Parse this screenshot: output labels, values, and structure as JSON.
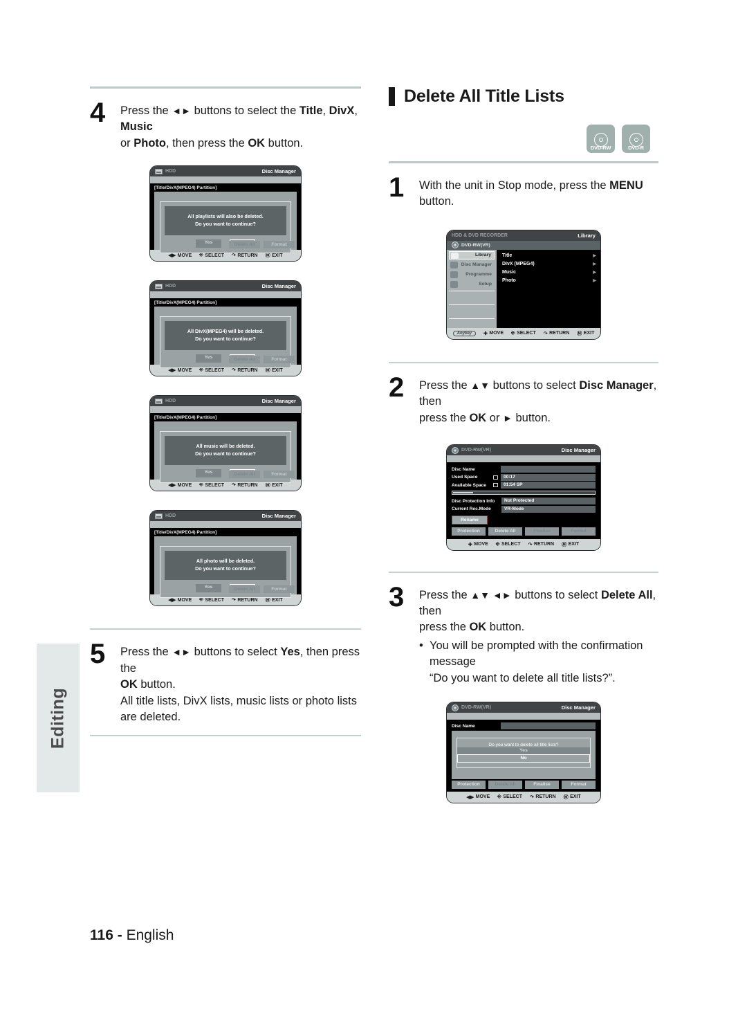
{
  "side_tab": {
    "label": "Editing"
  },
  "footer": {
    "page": "116 -",
    "language": "English"
  },
  "left_column": {
    "step4": {
      "number": "4",
      "text_parts": [
        {
          "t": "Press the ",
          "b": false
        },
        {
          "t": "◄►",
          "b": false
        },
        {
          "t": " buttons to select the ",
          "b": false
        },
        {
          "t": "Title",
          "b": true
        },
        {
          "t": ", ",
          "b": false
        },
        {
          "t": "DivX",
          "b": true
        },
        {
          "t": ", ",
          "b": false
        },
        {
          "t": "Music",
          "b": true
        },
        {
          "t": " or ",
          "b": false
        },
        {
          "t": "Photo",
          "b": true
        },
        {
          "t": ", then press the ",
          "b": false
        },
        {
          "t": "OK",
          "b": true
        },
        {
          "t": " button.",
          "b": false
        }
      ],
      "plain": "Press the ◄► buttons to select the Title, DivX, Music or Photo, then press the OK button."
    },
    "step5": {
      "number": "5",
      "line1": "Press the ◄► buttons to select Yes, then press the",
      "line2": "OK button.",
      "line3": "All title lists, DivX lists, music lists or photo lists are deleted."
    },
    "shots": [
      {
        "name": "hdd-playlists-dialog",
        "source": "HDD",
        "title": "Disc Manager",
        "partition_label": "[Title/DivX(MPEG4) Partition]",
        "message_line1": "All playlists will also be deleted.",
        "message_line2": "Do you want to continue?",
        "yes": "Yes",
        "no": "No",
        "selected": "No",
        "low_buttons": [
          "Delete All",
          "Format"
        ],
        "bottom_bar": [
          "MOVE",
          "SELECT",
          "RETURN",
          "EXIT"
        ]
      },
      {
        "name": "hdd-divx-dialog",
        "source": "HDD",
        "title": "Disc Manager",
        "partition_label": "[Title/DivX(MPEG4) Partition]",
        "message_line1": "All DivX(MPEG4) will be deleted.",
        "message_line2": "Do you want to continue?",
        "yes": "Yes",
        "no": "No",
        "selected": "No",
        "low_buttons": [
          "Delete All",
          "Format"
        ],
        "bottom_bar": [
          "MOVE",
          "SELECT",
          "RETURN",
          "EXIT"
        ]
      },
      {
        "name": "hdd-music-dialog",
        "source": "HDD",
        "title": "Disc Manager",
        "partition_label": "[Title/DivX(MPEG4) Partition]",
        "message_line1": "All music will be deleted.",
        "message_line2": "Do you want to continue?",
        "yes": "Yes",
        "no": "No",
        "selected": "No",
        "low_buttons": [
          "Delete All",
          "Format"
        ],
        "bottom_bar": [
          "MOVE",
          "SELECT",
          "RETURN",
          "EXIT"
        ]
      },
      {
        "name": "hdd-photo-dialog",
        "source": "HDD",
        "title": "Disc Manager",
        "partition_label": "[Title/DivX(MPEG4) Partition]",
        "message_line1": "All photo will be deleted.",
        "message_line2": "Do you want to continue?",
        "yes": "Yes",
        "no": "No",
        "selected": "No",
        "low_buttons": [
          "Delete All",
          "Format"
        ],
        "bottom_bar": [
          "MOVE",
          "SELECT",
          "RETURN",
          "EXIT"
        ]
      }
    ]
  },
  "right_column": {
    "section_title": "Delete All Title Lists",
    "disc_badges": [
      {
        "label": "DVD-RW"
      },
      {
        "label": "DVD-R"
      }
    ],
    "step1": {
      "number": "1",
      "line1": "With the unit in Stop mode, press the MENU",
      "line2": "button."
    },
    "step2": {
      "number": "2",
      "line1": "Press the ▲▼ buttons to select Disc Manager, then",
      "line2": "press the OK or ► button."
    },
    "step3": {
      "number": "3",
      "line1": "Press the ▲▼ ◄► buttons to select Delete All, then",
      "line2": "press the OK button.",
      "bullet_dot": "•",
      "bullet_line1": "You will be prompted with the confirmation message",
      "bullet_line2": "“Do you want to delete all title lists?”."
    },
    "library_shot": {
      "name": "library-menu",
      "header_left": "HDD & DVD RECORDER",
      "header_right": "Library",
      "disc_name": "DVD-RW(VR)",
      "menu_items": [
        {
          "label": "Library",
          "active": true
        },
        {
          "label": "Disc Manager",
          "active": false
        },
        {
          "label": "Programme",
          "active": false
        },
        {
          "label": "Setup",
          "active": false
        }
      ],
      "list_items": [
        "Title",
        "DivX (MPEG4)",
        "Music",
        "Photo"
      ],
      "anykey": "Anykey",
      "bottom_bar": [
        "MOVE",
        "SELECT",
        "RETURN",
        "EXIT"
      ]
    },
    "disc_manager_shot": {
      "name": "disc-manager-screen",
      "header_left": "DVD-RW(VR)",
      "header_right": "Disc Manager",
      "rows": [
        {
          "key": "Disc Name",
          "value": "",
          "icon": false
        },
        {
          "key": "Used Space",
          "value": "00:17",
          "icon": true
        },
        {
          "key": "Available Space",
          "value": "01:54 SP",
          "icon": true
        }
      ],
      "info_rows": [
        {
          "key": "Disc Protection Info",
          "value": "Not Protected"
        },
        {
          "key": "Current Rec.Mode",
          "value": "VR-Mode"
        }
      ],
      "rename": "Rename",
      "buttons": [
        "Protection",
        "Delete All",
        "Finalise",
        "Format"
      ],
      "bottom_bar": [
        "MOVE",
        "SELECT",
        "RETURN",
        "EXIT"
      ]
    },
    "confirm_shot": {
      "name": "delete-all-confirm",
      "header_left": "DVD-RW(VR)",
      "header_right": "Disc Manager",
      "disc_name_label": "Disc Name",
      "message": "Do you want to delete all title lists?",
      "yes": "Yes",
      "no": "No",
      "selected": "No",
      "buttons": [
        "Protection",
        "Delete All",
        "Finalise",
        "Format"
      ],
      "bottom_bar": [
        "MOVE",
        "SELECT",
        "RETURN",
        "EXIT"
      ]
    }
  }
}
